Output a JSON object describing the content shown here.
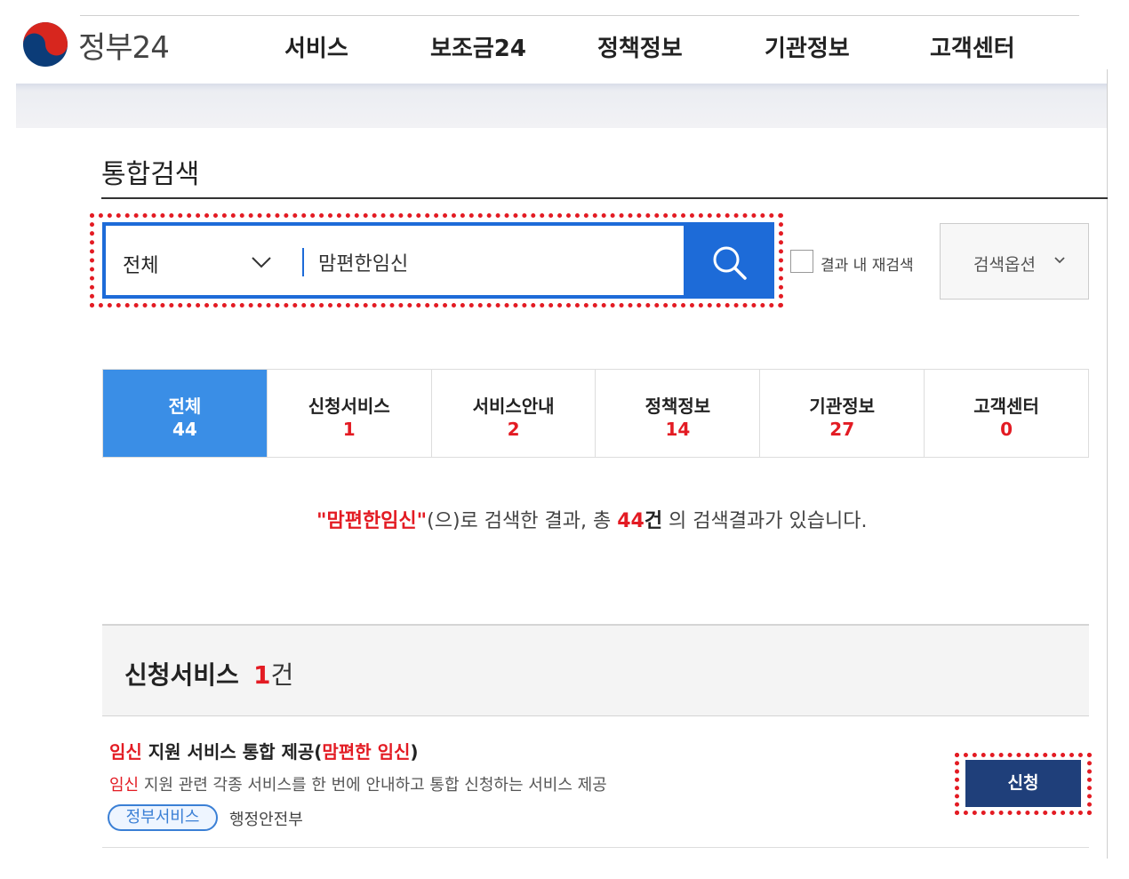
{
  "header": {
    "logo_text": "정부24",
    "nav": [
      "서비스",
      "보조금24",
      "정책정보",
      "기관정보",
      "고객센터"
    ]
  },
  "page_title": "통합검색",
  "search": {
    "scope_label": "전체",
    "query": "맘편한임신",
    "recheck_label": "결과 내 재검색",
    "options_label": "검색옵션"
  },
  "tabs": [
    {
      "label": "전체",
      "count": "44",
      "active": true
    },
    {
      "label": "신청서비스",
      "count": "1"
    },
    {
      "label": "서비스안내",
      "count": "2"
    },
    {
      "label": "정책정보",
      "count": "14"
    },
    {
      "label": "기관정보",
      "count": "27"
    },
    {
      "label": "고객센터",
      "count": "0"
    }
  ],
  "summary": {
    "query_quoted": "\"맘편한임신\"",
    "text1": "(으)로 검색한 결과, 총 ",
    "count": "44",
    "unit": "건",
    "text2": " 의 검색결과가 있습니다."
  },
  "section": {
    "title": "신청서비스",
    "count": "1",
    "unit": "건"
  },
  "item": {
    "title_highlight": "임신",
    "title_mid": " 지원 서비스 통합 제공(",
    "title_highlight2": "맘편한 임신",
    "title_end": ")",
    "desc_highlight": "임신",
    "desc_rest": " 지원 관련 각종 서비스를 한 번에 안내하고 통합 신청하는 서비스 제공",
    "badge": "정부서비스",
    "org": "행정안전부",
    "apply_label": "신청"
  },
  "colors": {
    "accent_blue": "#1d6bd8",
    "active_tab": "#3a8ee6",
    "highlight_red": "#e31b23",
    "apply_navy": "#1f3f7a"
  }
}
